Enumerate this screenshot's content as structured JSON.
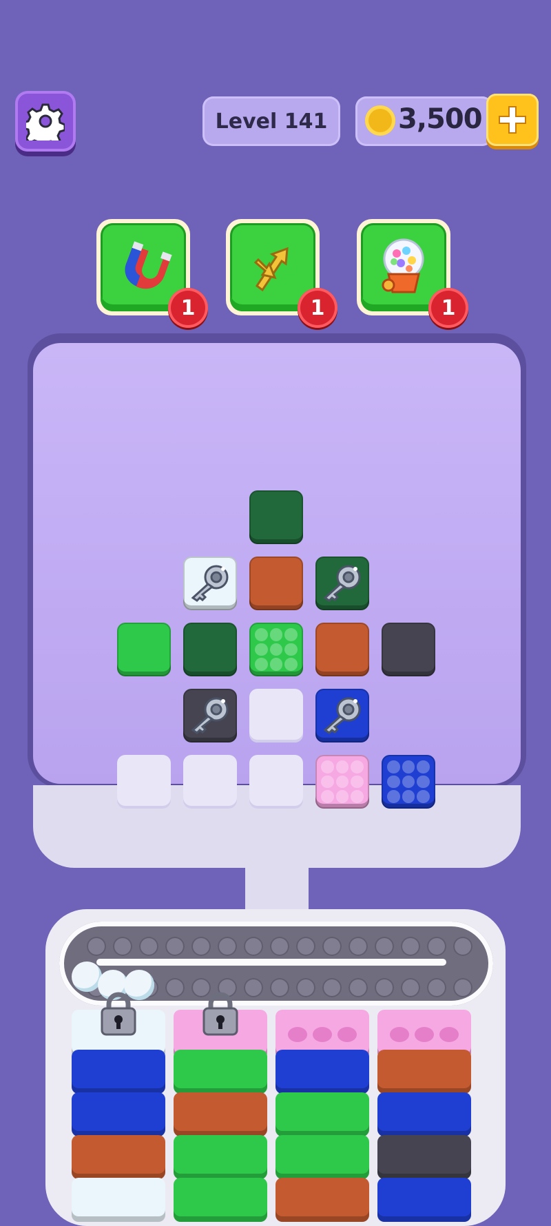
{
  "hud": {
    "level_label": "Level 141",
    "coins": "3,500"
  },
  "boosters": [
    {
      "name": "magnet",
      "count": "1"
    },
    {
      "name": "shuffle-arrows",
      "count": "1"
    },
    {
      "name": "gumball-machine",
      "count": "1"
    }
  ],
  "colors": {
    "background": "#6e63b8",
    "dark_green": "#21683a",
    "light_green": "#2ec94b",
    "orange": "#c45a30",
    "dark_gray": "#454450",
    "light_blue_white": "#eaf6fb",
    "blue": "#1f3fd2",
    "pink": "#f6a8e2"
  },
  "board": {
    "tiles": [
      {
        "row": 0,
        "col": 3,
        "color": "dark_green",
        "type": "plain"
      },
      {
        "row": 1,
        "col": 2,
        "color": "light_blue_white",
        "type": "key"
      },
      {
        "row": 1,
        "col": 3,
        "color": "orange",
        "type": "plain"
      },
      {
        "row": 1,
        "col": 4,
        "color": "dark_green",
        "type": "key"
      },
      {
        "row": 2,
        "col": 1,
        "color": "light_green",
        "type": "plain"
      },
      {
        "row": 2,
        "col": 2,
        "color": "dark_green",
        "type": "plain"
      },
      {
        "row": 2,
        "col": 3,
        "color": "light_green",
        "type": "studs"
      },
      {
        "row": 2,
        "col": 4,
        "color": "orange",
        "type": "plain"
      },
      {
        "row": 2,
        "col": 5,
        "color": "dark_gray",
        "type": "plain"
      },
      {
        "row": 3,
        "col": 2,
        "color": "dark_gray",
        "type": "key"
      },
      {
        "row": 3,
        "col": 3,
        "color": "empty",
        "type": "empty"
      },
      {
        "row": 3,
        "col": 4,
        "color": "blue",
        "type": "key"
      },
      {
        "row": 4,
        "col": 1,
        "color": "empty",
        "type": "empty"
      },
      {
        "row": 4,
        "col": 2,
        "color": "empty",
        "type": "empty"
      },
      {
        "row": 4,
        "col": 3,
        "color": "empty",
        "type": "empty"
      },
      {
        "row": 4,
        "col": 4,
        "color": "pink",
        "type": "studs"
      },
      {
        "row": 4,
        "col": 5,
        "color": "blue",
        "type": "studs"
      }
    ]
  },
  "conveyor": {
    "balls": 3
  },
  "columns": [
    {
      "top": "light_blue_white",
      "locked": true,
      "blocks": [
        "blue",
        "blue",
        "orange",
        "light_blue_white"
      ]
    },
    {
      "top": "pink",
      "locked": true,
      "blocks": [
        "light_green",
        "orange",
        "light_green",
        "light_green"
      ]
    },
    {
      "top": "pink",
      "locked": false,
      "blocks": [
        "blue",
        "light_green",
        "light_green",
        "orange"
      ]
    },
    {
      "top": "pink",
      "locked": false,
      "blocks": [
        "orange",
        "blue",
        "dark_gray",
        "blue"
      ]
    }
  ]
}
